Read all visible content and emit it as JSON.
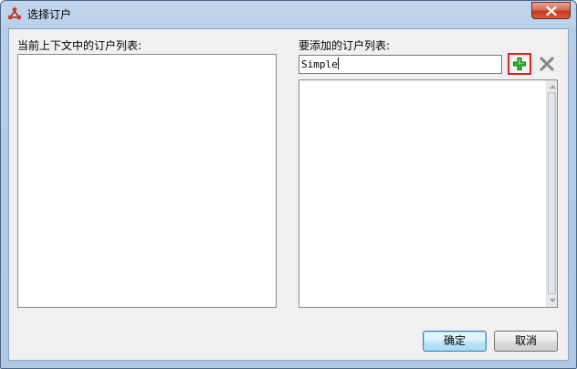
{
  "window": {
    "title": "选择订户"
  },
  "left_panel": {
    "label": "当前上下文中的订户列表:",
    "items": []
  },
  "right_panel": {
    "label": "要添加的订户列表:",
    "input_value": "Simple",
    "items": []
  },
  "buttons": {
    "ok_label": "确定",
    "cancel_label": "取消"
  },
  "icons": {
    "app": "app-logo-icon",
    "close": "close-icon",
    "add": "plus-icon",
    "remove": "x-icon"
  },
  "colors": {
    "add_icon": "#2aa02a",
    "highlight": "#e02020",
    "close_button": "#c4391c"
  }
}
